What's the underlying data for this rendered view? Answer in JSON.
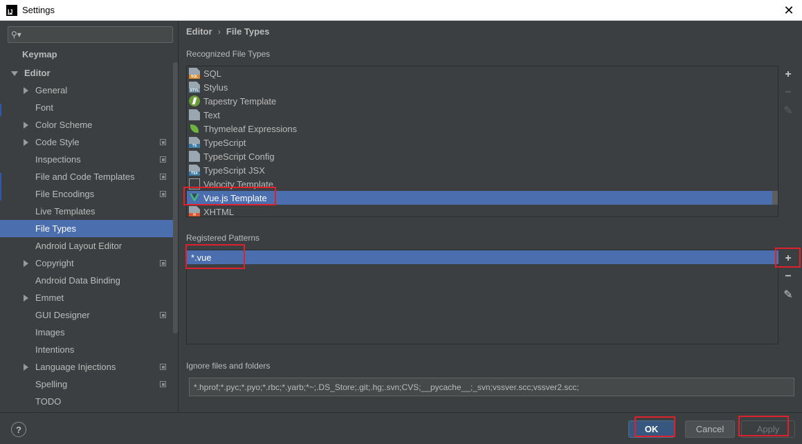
{
  "window": {
    "title": "Settings",
    "app_icon_text": "IJ",
    "close_glyph": "✕"
  },
  "search": {
    "placeholder": "",
    "icon": "search-icon"
  },
  "sidebar": {
    "items": [
      {
        "label": "Keymap",
        "indent": 0,
        "bold": true,
        "arrow": "none",
        "copy_icon": false,
        "selected": false
      },
      {
        "label": "Editor",
        "indent": 0,
        "bold": true,
        "arrow": "down",
        "copy_icon": false,
        "selected": false
      },
      {
        "label": "General",
        "indent": 1,
        "bold": false,
        "arrow": "right",
        "copy_icon": false,
        "selected": false
      },
      {
        "label": "Font",
        "indent": 1,
        "bold": false,
        "arrow": "none",
        "copy_icon": false,
        "selected": false
      },
      {
        "label": "Color Scheme",
        "indent": 1,
        "bold": false,
        "arrow": "right",
        "copy_icon": false,
        "selected": false
      },
      {
        "label": "Code Style",
        "indent": 1,
        "bold": false,
        "arrow": "right",
        "copy_icon": true,
        "selected": false
      },
      {
        "label": "Inspections",
        "indent": 1,
        "bold": false,
        "arrow": "none",
        "copy_icon": true,
        "selected": false
      },
      {
        "label": "File and Code Templates",
        "indent": 1,
        "bold": false,
        "arrow": "none",
        "copy_icon": true,
        "selected": false
      },
      {
        "label": "File Encodings",
        "indent": 1,
        "bold": false,
        "arrow": "none",
        "copy_icon": true,
        "selected": false
      },
      {
        "label": "Live Templates",
        "indent": 1,
        "bold": false,
        "arrow": "none",
        "copy_icon": false,
        "selected": false
      },
      {
        "label": "File Types",
        "indent": 1,
        "bold": false,
        "arrow": "none",
        "copy_icon": false,
        "selected": true
      },
      {
        "label": "Android Layout Editor",
        "indent": 1,
        "bold": false,
        "arrow": "none",
        "copy_icon": false,
        "selected": false
      },
      {
        "label": "Copyright",
        "indent": 1,
        "bold": false,
        "arrow": "right",
        "copy_icon": true,
        "selected": false
      },
      {
        "label": "Android Data Binding",
        "indent": 1,
        "bold": false,
        "arrow": "none",
        "copy_icon": false,
        "selected": false
      },
      {
        "label": "Emmet",
        "indent": 1,
        "bold": false,
        "arrow": "right",
        "copy_icon": false,
        "selected": false
      },
      {
        "label": "GUI Designer",
        "indent": 1,
        "bold": false,
        "arrow": "none",
        "copy_icon": true,
        "selected": false
      },
      {
        "label": "Images",
        "indent": 1,
        "bold": false,
        "arrow": "none",
        "copy_icon": false,
        "selected": false
      },
      {
        "label": "Intentions",
        "indent": 1,
        "bold": false,
        "arrow": "none",
        "copy_icon": false,
        "selected": false
      },
      {
        "label": "Language Injections",
        "indent": 1,
        "bold": false,
        "arrow": "right",
        "copy_icon": true,
        "selected": false
      },
      {
        "label": "Spelling",
        "indent": 1,
        "bold": false,
        "arrow": "none",
        "copy_icon": true,
        "selected": false
      },
      {
        "label": "TODO",
        "indent": 1,
        "bold": false,
        "arrow": "none",
        "copy_icon": false,
        "selected": false
      }
    ]
  },
  "breadcrumb": {
    "parent": "Editor",
    "separator": "›",
    "current": "File Types"
  },
  "recognized": {
    "label": "Recognized File Types",
    "items": [
      {
        "label": "SQL",
        "icon": "sql-file-icon",
        "kind": "doc sql",
        "tag": "SQL",
        "selected": false
      },
      {
        "label": "Stylus",
        "icon": "stylus-file-icon",
        "kind": "doc styl",
        "tag": "STYL",
        "selected": false
      },
      {
        "label": "Tapestry Template",
        "icon": "tapestry-icon",
        "kind": "tapestry",
        "tag": "",
        "selected": false
      },
      {
        "label": "Text",
        "icon": "text-file-icon",
        "kind": "doc",
        "tag": "",
        "selected": false
      },
      {
        "label": "Thymeleaf Expressions",
        "icon": "thymeleaf-leaf-icon",
        "kind": "thyme",
        "tag": "",
        "selected": false
      },
      {
        "label": "TypeScript",
        "icon": "typescript-file-icon",
        "kind": "doc ts",
        "tag": "TS",
        "selected": false
      },
      {
        "label": "TypeScript Config",
        "icon": "typescript-config-icon",
        "kind": "doc",
        "tag": "",
        "selected": false
      },
      {
        "label": "TypeScript JSX",
        "icon": "typescript-jsx-icon",
        "kind": "doc tsx",
        "tag": "TSX",
        "selected": false
      },
      {
        "label": "Velocity Template",
        "icon": "velocity-template-icon",
        "kind": "vel",
        "tag": "",
        "selected": false
      },
      {
        "label": "Vue.js Template",
        "icon": "vue-icon",
        "kind": "vue",
        "tag": "",
        "selected": true
      },
      {
        "label": "XHTML",
        "icon": "xhtml-file-icon",
        "kind": "doc html",
        "tag": "H",
        "selected": false
      }
    ],
    "tools": {
      "add": "+",
      "remove": "−",
      "edit": "✎"
    }
  },
  "patterns": {
    "label": "Registered Patterns",
    "items": [
      "*.vue"
    ],
    "tools": {
      "add": "+",
      "remove": "−",
      "edit": "✎"
    }
  },
  "ignore": {
    "label": "Ignore files and folders",
    "value": "*.hprof;*.pyc;*.pyo;*.rbc;*.yarb;*~;.DS_Store;.git;.hg;.svn;CVS;__pycache__;_svn;vssver.scc;vssver2.scc;"
  },
  "buttons": {
    "help": "?",
    "ok": "OK",
    "cancel": "Cancel",
    "apply": "Apply"
  },
  "colors": {
    "selection": "#4b6eaf",
    "background": "#3c3f41",
    "highlight_box": "#e0202a"
  }
}
